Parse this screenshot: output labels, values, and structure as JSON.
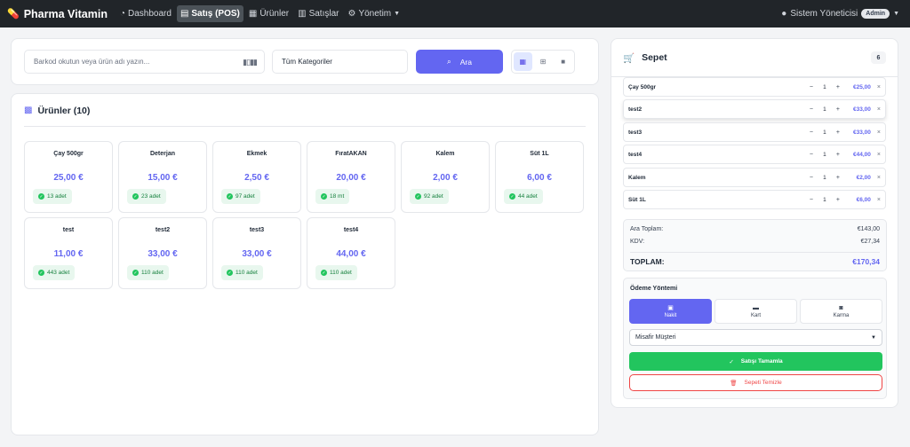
{
  "navbar": {
    "brand": "Pharma Vitamin",
    "items": [
      {
        "label": "Dashboard",
        "icon": "gauge-icon",
        "active": false
      },
      {
        "label": "Satış (POS)",
        "icon": "register-icon",
        "active": true
      },
      {
        "label": "Ürünler",
        "icon": "boxes-icon",
        "active": false
      },
      {
        "label": "Satışlar",
        "icon": "receipt-icon",
        "active": false
      },
      {
        "label": "Yönetim",
        "icon": "gear-icon",
        "active": false
      }
    ],
    "user": "Sistem Yöneticisi",
    "role": "Admin"
  },
  "search": {
    "placeholder": "Barkod okutun veya ürün adı yazın...",
    "category": "Tüm Kategoriler",
    "button": "Ara"
  },
  "products": {
    "title": "Ürünler (10)",
    "items": [
      {
        "name": "Çay 500gr",
        "price": "25,00 €",
        "stock": "13 adet"
      },
      {
        "name": "Deterjan",
        "price": "15,00 €",
        "stock": "23 adet"
      },
      {
        "name": "Ekmek",
        "price": "2,50 €",
        "stock": "97 adet"
      },
      {
        "name": "FıratAKAN",
        "price": "20,00 €",
        "stock": "18 mt"
      },
      {
        "name": "Kalem",
        "price": "2,00 €",
        "stock": "92 adet"
      },
      {
        "name": "Süt 1L",
        "price": "6,00 €",
        "stock": "44 adet"
      },
      {
        "name": "test",
        "price": "11,00 €",
        "stock": "443 adet"
      },
      {
        "name": "test2",
        "price": "33,00 €",
        "stock": "110 adet"
      },
      {
        "name": "test3",
        "price": "33,00 €",
        "stock": "110 adet"
      },
      {
        "name": "test4",
        "price": "44,00 €",
        "stock": "110 adet"
      }
    ]
  },
  "cart": {
    "title": "Sepet",
    "count": "6",
    "items": [
      {
        "name": "Çay 500gr",
        "qty": "1",
        "price": "€25,00"
      },
      {
        "name": "test2",
        "qty": "1",
        "price": "€33,00"
      },
      {
        "name": "test3",
        "qty": "1",
        "price": "€33,00"
      },
      {
        "name": "test4",
        "qty": "1",
        "price": "€44,00"
      },
      {
        "name": "Kalem",
        "qty": "1",
        "price": "€2,00"
      },
      {
        "name": "Süt 1L",
        "qty": "1",
        "price": "€6,00"
      }
    ],
    "subtotal_label": "Ara Toplam:",
    "subtotal": "€143,00",
    "tax_label": "KDV:",
    "tax": "€27,34",
    "total_label": "TOPLAM:",
    "total": "€170,34"
  },
  "payment": {
    "title": "Ödeme Yöntemi",
    "methods": [
      {
        "label": "Nakit",
        "icon": "cash-icon",
        "active": true
      },
      {
        "label": "Kart",
        "icon": "card-icon",
        "active": false
      },
      {
        "label": "Karma",
        "icon": "coins-icon",
        "active": false
      }
    ],
    "customer": "Misafir Müşteri",
    "complete_label": "Satışı Tamamla",
    "clear_label": "Sepeti Temizle"
  },
  "colors": {
    "accent": "#6366f1",
    "success": "#22c55e",
    "danger": "#ef4444",
    "navbar": "#212529"
  }
}
